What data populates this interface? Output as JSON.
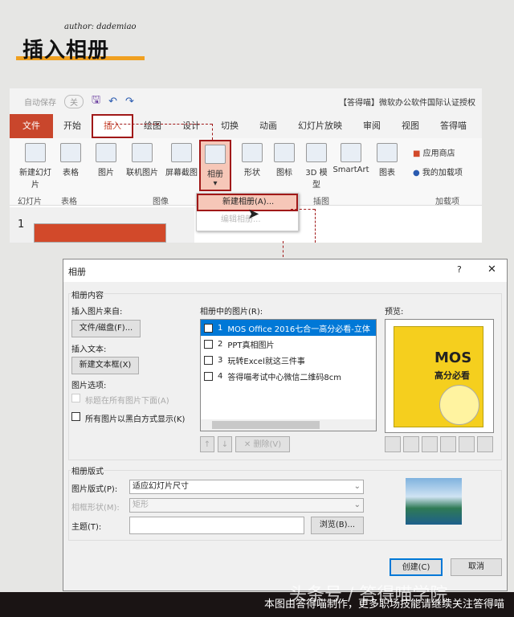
{
  "header": {
    "author": "author: dademiao",
    "title": "插入相册"
  },
  "ppt": {
    "qat": {
      "autosave": "自动保存",
      "toggle": "关",
      "window_title": "【答得喵】微软办公软件国际认证授权"
    },
    "tabs": [
      "文件",
      "开始",
      "插入",
      "绘图",
      "设计",
      "切换",
      "动画",
      "幻灯片放映",
      "审阅",
      "视图",
      "答得喵"
    ],
    "ribbon": {
      "new_slide": "新建幻灯片",
      "table": "表格",
      "picture": "图片",
      "online_picture": "联机图片",
      "screenshot": "屏幕截图",
      "album": "相册",
      "shapes": "形状",
      "icons": "图标",
      "model3d": "3D 模型",
      "smartart": "SmartArt",
      "chart": "图表",
      "store": "应用商店",
      "addins": "我的加载项"
    },
    "groups": [
      "幻灯片",
      "表格",
      "图像",
      "插图",
      "加载项"
    ],
    "menu": [
      "新建相册(A)...",
      "编辑相册..."
    ],
    "slide_number": "1"
  },
  "dialog": {
    "title": "相册",
    "help": "?",
    "close": "✕",
    "content_group": "相册内容",
    "insert_from": "插入图片来自:",
    "file_button": "文件/磁盘(F)...",
    "insert_text": "插入文本:",
    "textbox_button": "新建文本框(X)",
    "picture_options": "图片选项:",
    "caption_option": "标题在所有图片下面(A)",
    "bw_option": "所有图片以黑白方式显示(K)",
    "list_label": "相册中的图片(R):",
    "pictures": [
      {
        "n": "1",
        "name": "MOS Office 2016七合一高分必看-立体"
      },
      {
        "n": "2",
        "name": "PPT真相图片"
      },
      {
        "n": "3",
        "name": "玩转Excel就这三件事"
      },
      {
        "n": "4",
        "name": "答得喵考试中心微信二维码8cm"
      }
    ],
    "up": "↑",
    "down": "↓",
    "remove": "✕ 删除(V)",
    "preview_label": "预览:",
    "preview_book_title": "MOS",
    "preview_book_sub": "高分必看",
    "layout_group": "相册版式",
    "picture_layout_label": "图片版式(P):",
    "picture_layout_value": "适应幻灯片尺寸",
    "frame_label": "相框形状(M):",
    "frame_value": "矩形",
    "theme_label": "主题(T):",
    "theme_value": "",
    "browse": "浏览(B)...",
    "create": "创建(C)",
    "cancel": "取消"
  },
  "footer": {
    "text": "本图由答得喵制作，更多职场技能请继续关注答得喵",
    "watermark": "头条号 / 答得喵学院"
  }
}
